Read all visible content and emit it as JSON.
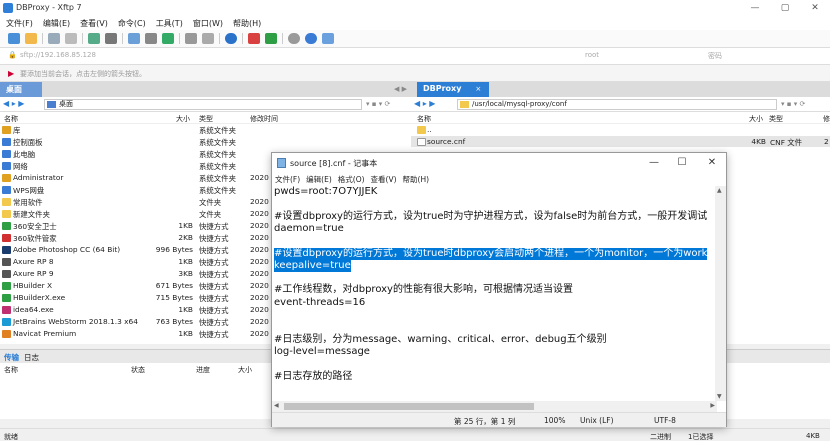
{
  "window": {
    "title": "DBProxy - Xftp 7",
    "minimize": "—",
    "maximize": "▢",
    "close": "✕"
  },
  "menu": [
    "文件(F)",
    "编辑(E)",
    "查看(V)",
    "命令(C)",
    "工具(T)",
    "窗口(W)",
    "帮助(H)"
  ],
  "address": {
    "host": "sftp://192.168.85.128",
    "user": "root",
    "password": "密码"
  },
  "hint": "要添加当前会话，点击左侧的箭头按钮。",
  "left_tab": {
    "label": "桌面"
  },
  "right_tab": {
    "label": "DBProxy",
    "close": "×"
  },
  "left_path": "桌面",
  "right_path": "/usr/local/mysql-proxy/conf",
  "left_columns": [
    "名称",
    "大小",
    "类型",
    "修改时间"
  ],
  "right_columns": [
    "名称",
    "大小",
    "类型",
    "修"
  ],
  "left_files": [
    {
      "name": "库",
      "size": "",
      "type": "系统文件夹",
      "date": "",
      "icon": "#e0a020"
    },
    {
      "name": "控制面板",
      "size": "",
      "type": "系统文件夹",
      "date": "",
      "icon": "#3a7bd5"
    },
    {
      "name": "此电脑",
      "size": "",
      "type": "系统文件夹",
      "date": "",
      "icon": "#3a7bd5"
    },
    {
      "name": "网络",
      "size": "",
      "type": "系统文件夹",
      "date": "",
      "icon": "#3a7bd5"
    },
    {
      "name": "Administrator",
      "size": "",
      "type": "系统文件夹",
      "date": "2020",
      "icon": "#e0a020"
    },
    {
      "name": "WPS网盘",
      "size": "",
      "type": "系统文件夹",
      "date": "",
      "icon": "#3a7bd5"
    },
    {
      "name": "常用软件",
      "size": "",
      "type": "文件夹",
      "date": "2020",
      "icon": "#f2c94c"
    },
    {
      "name": "新建文件夹",
      "size": "",
      "type": "文件夹",
      "date": "2020",
      "icon": "#f2c94c"
    },
    {
      "name": "360安全卫士",
      "size": "1KB",
      "type": "快捷方式",
      "date": "2020",
      "icon": "#2ea043"
    },
    {
      "name": "360软件管家",
      "size": "2KB",
      "type": "快捷方式",
      "date": "2020",
      "icon": "#d03030"
    },
    {
      "name": "Adobe Photoshop CC (64 Bit)",
      "size": "996 Bytes",
      "type": "快捷方式",
      "date": "2020",
      "icon": "#1a3b6e"
    },
    {
      "name": "Axure RP 8",
      "size": "1KB",
      "type": "快捷方式",
      "date": "2020",
      "icon": "#555555"
    },
    {
      "name": "Axure RP 9",
      "size": "3KB",
      "type": "快捷方式",
      "date": "2020",
      "icon": "#555555"
    },
    {
      "name": "HBuilder X",
      "size": "671 Bytes",
      "type": "快捷方式",
      "date": "2020",
      "icon": "#2ea043"
    },
    {
      "name": "HBuilderX.exe",
      "size": "715 Bytes",
      "type": "快捷方式",
      "date": "2020",
      "icon": "#2ea043"
    },
    {
      "name": "idea64.exe",
      "size": "1KB",
      "type": "快捷方式",
      "date": "2020",
      "icon": "#c03070"
    },
    {
      "name": "JetBrains WebStorm 2018.1.3 x64",
      "size": "763 Bytes",
      "type": "快捷方式",
      "date": "2020",
      "icon": "#1a9bd5"
    },
    {
      "name": "Navicat Premium",
      "size": "1KB",
      "type": "快捷方式",
      "date": "2020",
      "icon": "#e08020"
    }
  ],
  "right_files": [
    {
      "name": "..",
      "size": "",
      "type": "",
      "date": "",
      "icon": "#f2c94c"
    },
    {
      "name": "source.cnf",
      "size": "4KB",
      "type": "CNF 文件",
      "date": "2",
      "icon": "#ffffff"
    }
  ],
  "transfer": {
    "tabs": [
      "传输",
      "日志"
    ],
    "columns": [
      "名称",
      "状态",
      "进度",
      "大小"
    ]
  },
  "status": {
    "left": "就绪",
    "mode": "二进制",
    "selected": "1已选择",
    "size": "4KB"
  },
  "notepad": {
    "title": "source [8].cnf - 记事本",
    "minimize": "—",
    "maximize": "☐",
    "close": "✕",
    "menu": [
      "文件(F)",
      "编辑(E)",
      "格式(O)",
      "查看(V)",
      "帮助(H)"
    ],
    "lines": [
      "pwds=root:7O7YJJEK",
      "",
      "#设置dbproxy的运行方式，设为true时为守护进程方式，设为false时为前台方式，一般开发调试",
      "daemon=true",
      "",
      "#设置dbproxy的运行方式，设为true时dbproxy会启动两个进程，一个为monitor，一个为work",
      "keepalive=true",
      "",
      "#工作线程数，对dbproxy的性能有很大影响，可根据情况适当设置",
      "event-threads=16",
      "",
      "",
      "#日志级别，分为message、warning、critical、error、debug五个级别",
      "log-level=message",
      "",
      "#日志存放的路径"
    ],
    "highlighted_lines": [
      5,
      6
    ],
    "status": {
      "position": "第 25 行，第 1 列",
      "zoom": "100%",
      "eol": "Unix (LF)",
      "encoding": "UTF-8"
    }
  }
}
